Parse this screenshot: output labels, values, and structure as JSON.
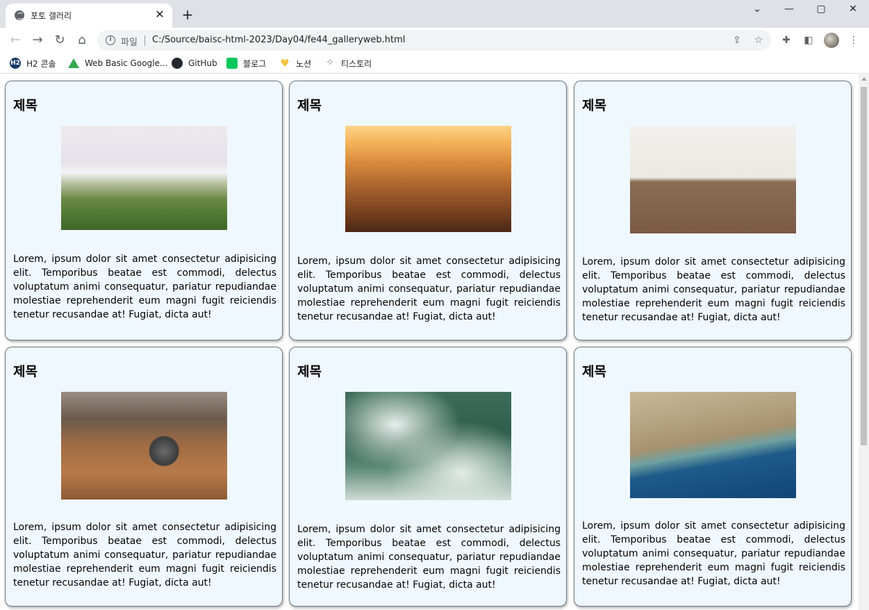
{
  "browser": {
    "tab_title": "포토 갤러리",
    "tab_close": "✕",
    "new_tab": "+",
    "window_controls": {
      "menu": "⌄",
      "minimize": "—",
      "maximize": "▢",
      "close": "✕"
    },
    "nav": {
      "back": "←",
      "forward": "→",
      "reload": "↻",
      "home": "⌂"
    },
    "address": {
      "info": "i",
      "scheme_label": "파일",
      "url": "C:/Source/baisc-html-2023/Day04/fe44_galleryweb.html"
    },
    "icons": {
      "share": "share-icon",
      "star": "star-icon",
      "extensions": "puzzle-icon",
      "sidepanel": "sidepanel-icon",
      "menu": "kebab-menu-icon"
    },
    "bookmarks": [
      {
        "label": "H2 콘솔",
        "icon": "h2-icon",
        "color": "#1a3a6b"
      },
      {
        "label": "Web Basic Google...",
        "icon": "google-drive-icon",
        "color": "#34a853"
      },
      {
        "label": "GitHub",
        "icon": "github-icon",
        "color": "#24292f"
      },
      {
        "label": "블로그",
        "icon": "naver-blog-icon",
        "color": "#03c75a"
      },
      {
        "label": "노션",
        "icon": "heart-icon",
        "color": "#f5c242"
      },
      {
        "label": "티스토리",
        "icon": "tistory-icon",
        "color": "#333333"
      }
    ]
  },
  "gallery": {
    "card_bg": "#f0f8ff",
    "cards": [
      {
        "title": "제목",
        "image": "mountain-fog-photo",
        "text": "Lorem, ipsum dolor sit amet consectetur adipisicing elit. Temporibus beatae est commodi, delectus voluptatum animi consequatur, pariatur repudiandae molestiae reprehenderit eum magni fugit reiciendis tenetur recusandae at! Fugiat, dicta aut!"
      },
      {
        "title": "제목",
        "image": "city-sunset-photo",
        "text": "Lorem, ipsum dolor sit amet consectetur adipisicing elit. Temporibus beatae est commodi, delectus voluptatum animi consequatur, pariatur repudiandae molestiae reprehenderit eum magni fugit reiciendis tenetur recusandae at! Fugiat, dicta aut!"
      },
      {
        "title": "제목",
        "image": "field-photo",
        "text": "Lorem, ipsum dolor sit amet consectetur adipisicing elit. Temporibus beatae est commodi, delectus voluptatum animi consequatur, pariatur repudiandae molestiae reprehenderit eum magni fugit reiciendis tenetur recusandae at! Fugiat, dicta aut!"
      },
      {
        "title": "제목",
        "image": "desk-tools-photo",
        "text": "Lorem, ipsum dolor sit amet consectetur adipisicing elit. Temporibus beatae est commodi, delectus voluptatum animi consequatur, pariatur repudiandae molestiae reprehenderit eum magni fugit reiciendis tenetur recusandae at! Fugiat, dicta aut!"
      },
      {
        "title": "제목",
        "image": "ocean-waves-photo",
        "text": "Lorem, ipsum dolor sit amet consectetur adipisicing elit. Temporibus beatae est commodi, delectus voluptatum animi consequatur, pariatur repudiandae molestiae reprehenderit eum magni fugit reiciendis tenetur recusandae at! Fugiat, dicta aut!"
      },
      {
        "title": "제목",
        "image": "coastline-aerial-photo",
        "text": "Lorem, ipsum dolor sit amet consectetur adipisicing elit. Temporibus beatae est commodi, delectus voluptatum animi consequatur, pariatur repudiandae molestiae reprehenderit eum magni fugit reiciendis tenetur recusandae at! Fugiat, dicta aut!"
      }
    ]
  }
}
